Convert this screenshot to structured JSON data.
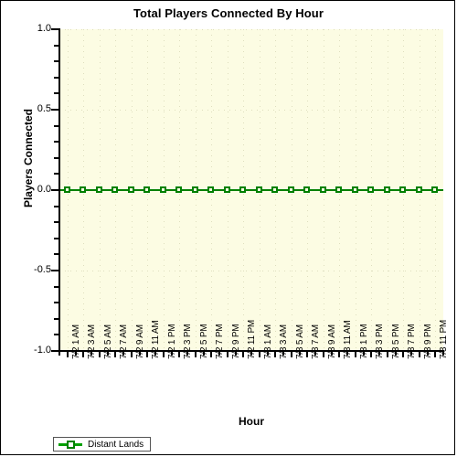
{
  "chart_data": {
    "type": "line",
    "title": "Total Players Connected By Hour",
    "xlabel": "Hour",
    "ylabel": "Players Connected",
    "ylim": [
      -1.0,
      1.0
    ],
    "ytick_labels": [
      "1.0",
      "0.5",
      "0.0",
      "-0.5",
      "-1.0"
    ],
    "ytick_values": [
      1.0,
      0.5,
      0.0,
      -0.5,
      -1.0
    ],
    "grid": true,
    "legend_position": "bottom-left",
    "categories": [
      "7/2 1 AM",
      "7/2 3 AM",
      "7/2 5 AM",
      "7/2 7 AM",
      "7/2 9 AM",
      "7/2 11 AM",
      "7/2 1 PM",
      "7/2 3 PM",
      "7/2 5 PM",
      "7/2 7 PM",
      "7/2 9 PM",
      "7/2 11 PM",
      "7/3 1 AM",
      "7/3 3 AM",
      "7/3 5 AM",
      "7/3 7 AM",
      "7/3 9 AM",
      "7/3 11 AM",
      "7/3 1 PM",
      "7/3 3 PM",
      "7/3 5 PM",
      "7/3 7 PM",
      "7/3 9 PM",
      "7/3 11 PM"
    ],
    "series": [
      {
        "name": "Distant Lands",
        "color": "#008000",
        "values": [
          0,
          0,
          0,
          0,
          0,
          0,
          0,
          0,
          0,
          0,
          0,
          0,
          0,
          0,
          0,
          0,
          0,
          0,
          0,
          0,
          0,
          0,
          0,
          0
        ]
      }
    ]
  },
  "legend": {
    "entries": [
      {
        "label": "Distant Lands",
        "color": "#008000"
      }
    ]
  },
  "colors": {
    "plot_background": "#fcfce3",
    "canvas_background": "#ffffff",
    "series_green": "#008000",
    "axis_black": "#000000",
    "gridline": "#dedebe"
  }
}
